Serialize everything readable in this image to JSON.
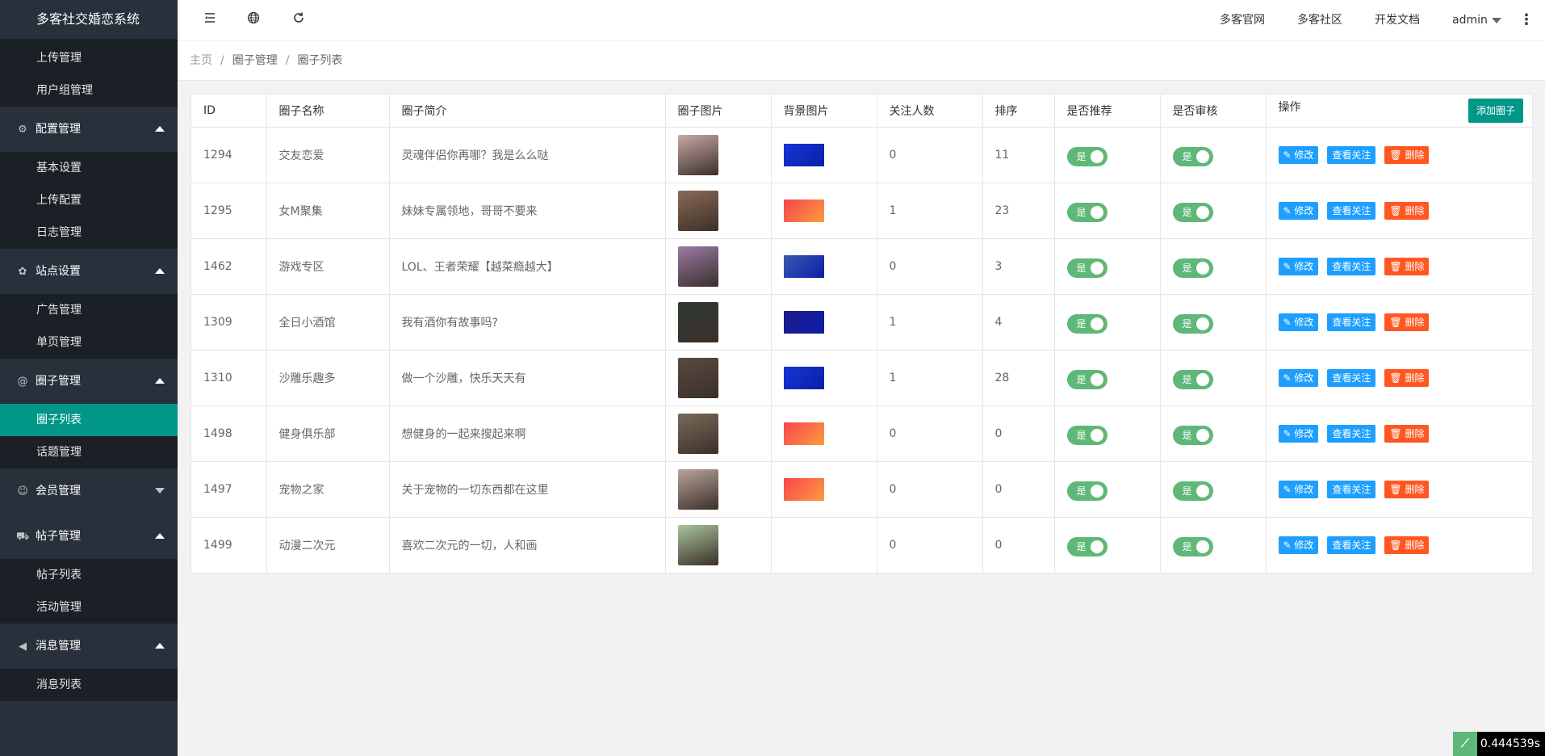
{
  "app": {
    "title": "多客社交婚恋系统"
  },
  "sidebar": {
    "top_items": [
      {
        "label": "上传管理"
      },
      {
        "label": "用户组管理"
      }
    ],
    "groups": [
      {
        "label": "配置管理",
        "icon": "gear-icon",
        "expanded": true,
        "items": [
          {
            "label": "基本设置"
          },
          {
            "label": "上传配置"
          },
          {
            "label": "日志管理"
          }
        ]
      },
      {
        "label": "站点设置",
        "icon": "palette-icon",
        "expanded": true,
        "items": [
          {
            "label": "广告管理"
          },
          {
            "label": "单页管理"
          }
        ]
      },
      {
        "label": "圈子管理",
        "icon": "at-icon",
        "expanded": true,
        "items": [
          {
            "label": "圈子列表",
            "active": true
          },
          {
            "label": "话题管理"
          }
        ]
      },
      {
        "label": "会员管理",
        "icon": "user-icon",
        "expanded": false,
        "items": []
      },
      {
        "label": "帖子管理",
        "icon": "cart-icon",
        "expanded": true,
        "items": [
          {
            "label": "帖子列表"
          },
          {
            "label": "活动管理"
          }
        ]
      },
      {
        "label": "消息管理",
        "icon": "speaker-icon",
        "expanded": true,
        "items": [
          {
            "label": "消息列表"
          }
        ]
      }
    ]
  },
  "header": {
    "links": [
      "多客官网",
      "多客社区",
      "开发文档"
    ],
    "user": "admin"
  },
  "breadcrumb": [
    "主页",
    "圈子管理",
    "圈子列表"
  ],
  "table": {
    "headers": [
      "ID",
      "圈子名称",
      "圈子简介",
      "圈子图片",
      "背景图片",
      "关注人数",
      "排序",
      "是否推荐",
      "是否审核",
      "操作"
    ],
    "add_button": "添加圈子",
    "switch_label": "是",
    "actions": {
      "edit": "修改",
      "view": "查看关注",
      "delete": "删除"
    },
    "rows": [
      {
        "id": "1294",
        "name": "交友恋爱",
        "intro": "灵魂伴侣你再哪？我是么么哒",
        "followers": "0",
        "sort": "11",
        "img": "#c9a9a6",
        "bg": "#1735d6"
      },
      {
        "id": "1295",
        "name": "女M聚集",
        "intro": "妹妹专属领地，哥哥不要来",
        "followers": "1",
        "sort": "23",
        "img": "#8b6a55",
        "bg": "#f5464f"
      },
      {
        "id": "1462",
        "name": "游戏专区",
        "intro": "LOL、王者荣耀【越菜瘾越大】",
        "followers": "0",
        "sort": "3",
        "img": "#9a7aa8",
        "bg": "#3a5ab0"
      },
      {
        "id": "1309",
        "name": "全日小酒馆",
        "intro": "我有酒你有故事吗?",
        "followers": "1",
        "sort": "4",
        "img": "#2f3a33",
        "bg": "#1f1a8a"
      },
      {
        "id": "1310",
        "name": "沙雕乐趣多",
        "intro": "做一个沙雕，快乐天天有",
        "followers": "1",
        "sort": "28",
        "img": "#5a4a40",
        "bg": "#1735d6"
      },
      {
        "id": "1498",
        "name": "健身俱乐部",
        "intro": "想健身的一起来搜起来啊",
        "followers": "0",
        "sort": "0",
        "img": "#7a6a5a",
        "bg": "#f5464f"
      },
      {
        "id": "1497",
        "name": "宠物之家",
        "intro": "关于宠物的一切东西都在这里",
        "followers": "0",
        "sort": "0",
        "img": "#b9a49a",
        "bg": "#f5464f"
      },
      {
        "id": "1499",
        "name": "动漫二次元",
        "intro": "喜欢二次元的一切，人和画",
        "followers": "0",
        "sort": "0",
        "img": "#a8c49a",
        "bg": ""
      }
    ]
  },
  "timing": "0.444539s",
  "colors": {
    "accent": "#009688",
    "sidebar": "#28303b",
    "switch_on": "#5fb878",
    "btn_blue": "#1e9fff",
    "btn_red": "#ff5722"
  }
}
